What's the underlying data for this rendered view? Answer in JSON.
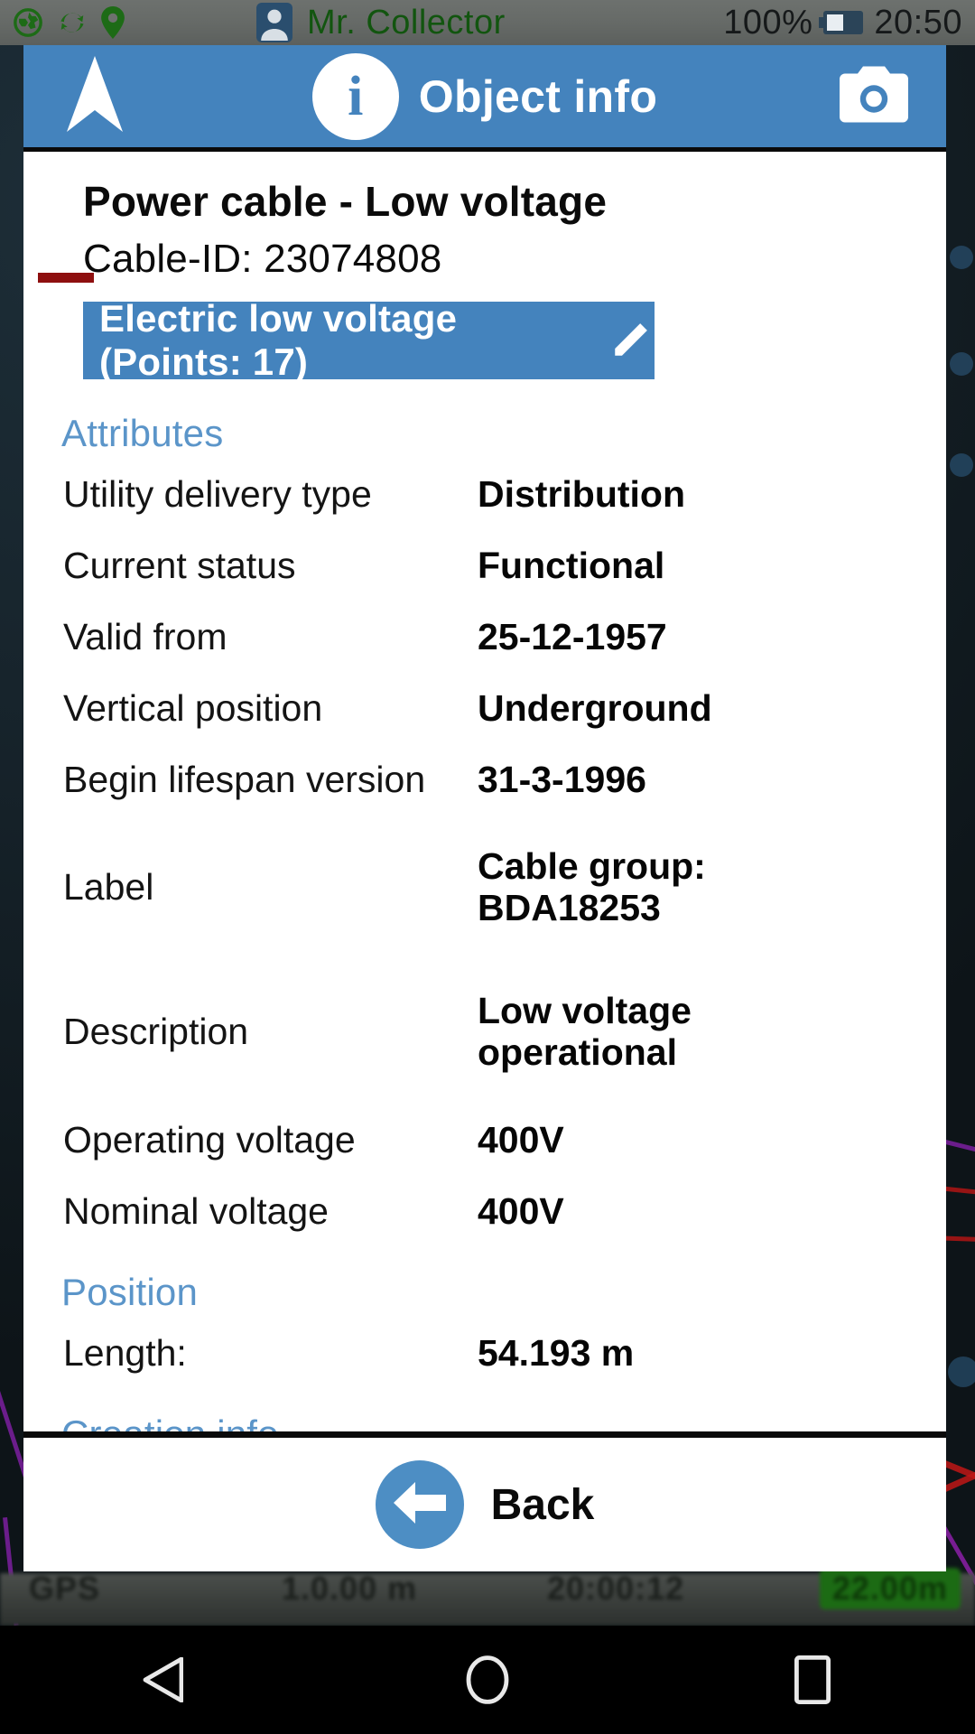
{
  "status_bar": {
    "left_icons": [
      "globe-icon",
      "sync-icon",
      "location-pin-icon"
    ],
    "user_icon": "contact-card-icon",
    "user_name": "Mr. Collector",
    "battery_percent": "100%",
    "battery_icon": "battery-icon",
    "clock": "20:50"
  },
  "dialog": {
    "header": {
      "nav_icon": "navigation-arrow-icon",
      "info_icon": "i",
      "title": "Object info",
      "camera_icon": "camera-icon"
    },
    "object": {
      "title": "Power cable - Low voltage",
      "subtitle": "Cable-ID: 23074808",
      "symbol_color": "#8e0f0f",
      "layer_chip": {
        "text": "Electric low voltage (Points: 17)",
        "edit_icon": "pencil-icon",
        "background": "#4483bd"
      }
    },
    "sections": {
      "attributes_label": "Attributes",
      "position_label": "Position",
      "creation_label": "Creation info"
    },
    "attributes": [
      {
        "key": "Utility delivery type",
        "value": "Distribution"
      },
      {
        "key": "Current status",
        "value": "Functional"
      },
      {
        "key": "Valid from",
        "value": "25-12-1957"
      },
      {
        "key": "Vertical position",
        "value": "Underground"
      },
      {
        "key": "Begin lifespan version",
        "value": "31-3-1996"
      },
      {
        "key": "Label",
        "value": "Cable group:\nBDA18253"
      },
      {
        "key": "Description",
        "value": "Low voltage\noperational"
      },
      {
        "key": "Operating voltage",
        "value": "400V"
      },
      {
        "key": "Nominal voltage",
        "value": "400V"
      }
    ],
    "position": [
      {
        "key": "Length:",
        "value": "54.193 m"
      }
    ],
    "footer": {
      "back_icon": "back-arrow-icon",
      "back_label": "Back"
    }
  },
  "map_status_bar": {
    "gps_label": "GPS",
    "accuracy": "1.0.00 m",
    "time": "20:00:12",
    "scale": "22.00m"
  },
  "nav_bar": {
    "back_icon": "triangle-back-icon",
    "home_icon": "circle-home-icon",
    "recents_icon": "square-recents-icon"
  },
  "colors": {
    "accent_blue": "#4483bd",
    "section_blue": "#5b95c9",
    "symbol_red": "#8e0f0f",
    "status_green": "#12550f"
  }
}
